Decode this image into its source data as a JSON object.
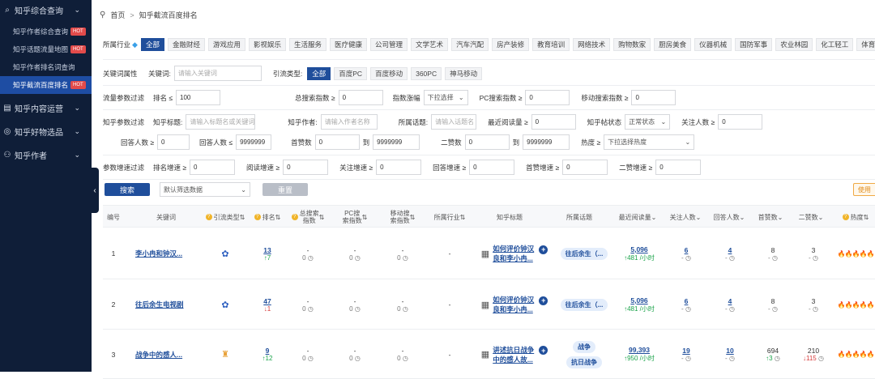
{
  "sidebar": {
    "groups": [
      {
        "label": "知乎综合查询"
      },
      {
        "label": "知乎内容运营"
      },
      {
        "label": "知乎好物选品"
      },
      {
        "label": "知乎作者"
      }
    ],
    "sub_items": [
      {
        "label": "知乎作者综合查询",
        "hot": "HOT"
      },
      {
        "label": "知乎话题流量地图",
        "hot": "HOT"
      },
      {
        "label": "知乎作者排名词查询",
        "hot": ""
      },
      {
        "label": "知乎截流百度排名",
        "hot": "HOT"
      }
    ]
  },
  "breadcrumb": {
    "home": "首页",
    "sep": ">",
    "current": "知乎截流百度排名"
  },
  "industry": {
    "label": "所属行业",
    "tags": [
      "全部",
      "金融财经",
      "游戏应用",
      "影视娱乐",
      "生活服务",
      "医疗健康",
      "公司管理",
      "文学艺术",
      "汽车汽配",
      "房产装修",
      "教育培训",
      "网络技术",
      "购物数家",
      "厨房美食",
      "仪器机械",
      "国防军事",
      "农业林园",
      "化工轻工",
      "体育运"
    ]
  },
  "keyword_attr": {
    "label": "关键词属性",
    "kw_label": "关键词:",
    "kw_placeholder": "请输入关键词",
    "traffic_label": "引流类型:",
    "traffic_tags": [
      "全部",
      "百度PC",
      "百度移动",
      "360PC",
      "神马移动"
    ]
  },
  "flow_filter": {
    "label": "流量参数过滤",
    "rank_label": "排名 ≤",
    "rank_value": "100",
    "total_label": "总搜索指数 ≥",
    "total_value": "0",
    "index_label": "指数涨幅",
    "index_select": "下拉选择",
    "pc_label": "PC搜索指数 ≥",
    "pc_value": "0",
    "mobile_label": "移动搜索指数 ≥",
    "mobile_value": "0"
  },
  "zhihu_filter": {
    "label": "知乎参数过滤",
    "title_label": "知乎标题:",
    "title_placeholder": "请输入标题名或关键词",
    "author_label": "知乎作者:",
    "author_placeholder": "请输入作者名称",
    "topic_label": "所属话题:",
    "topic_placeholder": "请输入话题名",
    "recent_read_label": "最近阅读量 ≥",
    "recent_read_value": "0",
    "status_label": "知乎帖状态",
    "status_value": "正常状态",
    "follow_label": "关注人数 ≥",
    "follow_value": "0",
    "answer_min_label": "回答人数 ≥",
    "answer_min_value": "0",
    "answer_max_label": "回答人数 ≤",
    "answer_max_value": "9999999",
    "first_label": "首赞数",
    "first_from": "0",
    "to_label": "到",
    "first_to": "9999999",
    "second_label": "二赞数",
    "second_from": "0",
    "second_to": "9999999",
    "heat_label": "热度 ≥",
    "heat_select": "下拉选择热度"
  },
  "growth_filter": {
    "label": "参数增速过滤",
    "items": [
      {
        "label": "排名增速 ≥",
        "value": "0"
      },
      {
        "label": "阅读增速 ≥",
        "value": "0"
      },
      {
        "label": "关注增速 ≥",
        "value": "0"
      },
      {
        "label": "回答增速 ≥",
        "value": "0"
      },
      {
        "label": "首赞增速 ≥",
        "value": "0"
      },
      {
        "label": "二赞增速 ≥",
        "value": "0"
      }
    ]
  },
  "actions": {
    "search": "搜索",
    "filter_select": "默认筛选数据",
    "reset": "重置",
    "guide": "使用"
  },
  "table": {
    "headers": {
      "no": "编号",
      "kw": "关键词",
      "traffic": "引流类型",
      "rank": "排名",
      "total": "总搜索\n指数",
      "pc": "PC搜\n索指数",
      "mobile": "移动搜\n索指数",
      "industry": "所属行业",
      "title": "知乎标题",
      "topic": "所属话题",
      "read": "最近阅读量",
      "follow": "关注人数",
      "answer": "回答人数",
      "first": "首赞数",
      "second": "二赞数",
      "heat": "热度"
    },
    "rows": [
      {
        "no": "1",
        "kw": "李小冉和钟汉...",
        "rank": "13",
        "rank_delta": "↑7",
        "total": "-",
        "total_sub": "0",
        "pc": "-",
        "pc_sub": "0",
        "mobile": "-",
        "mobile_sub": "0",
        "industry": "-",
        "title_1": "如何评价钟汉",
        "title_2": "良和李小冉...",
        "topics": [
          "往后余生（..."
        ],
        "read": "5,096",
        "read_delta": "↑481 /小时",
        "follow": "6",
        "follow_sub": "-",
        "answer": "4",
        "answer_sub": "-",
        "first": "8",
        "first_sub": "-",
        "second": "3",
        "second_sub": "-"
      },
      {
        "no": "2",
        "kw": "往后余生电视剧",
        "rank": "47",
        "rank_delta": "↓1",
        "total": "-",
        "total_sub": "0",
        "pc": "-",
        "pc_sub": "0",
        "mobile": "-",
        "mobile_sub": "0",
        "industry": "-",
        "title_1": "如何评价钟汉",
        "title_2": "良和李小冉...",
        "topics": [
          "往后余生（..."
        ],
        "read": "5,096",
        "read_delta": "↑481 /小时",
        "follow": "6",
        "follow_sub": "-",
        "answer": "4",
        "answer_sub": "-",
        "first": "8",
        "first_sub": "-",
        "second": "3",
        "second_sub": "-"
      },
      {
        "no": "3",
        "kw": "战争中的感人...",
        "rank": "9",
        "rank_delta": "↑12",
        "total": "-",
        "total_sub": "0",
        "pc": "-",
        "pc_sub": "0",
        "mobile": "-",
        "mobile_sub": "0",
        "industry": "-",
        "title_1": "讲述抗日战争",
        "title_2": "中的感人故...",
        "topics": [
          "战争",
          "抗日战争"
        ],
        "read": "99,393",
        "read_delta": "↑950 /小时",
        "follow": "19",
        "follow_sub": "-",
        "answer": "10",
        "answer_sub": "-",
        "first": "694",
        "first_sub": "↑3",
        "second": "210",
        "second_sub": "↓115"
      }
    ]
  }
}
